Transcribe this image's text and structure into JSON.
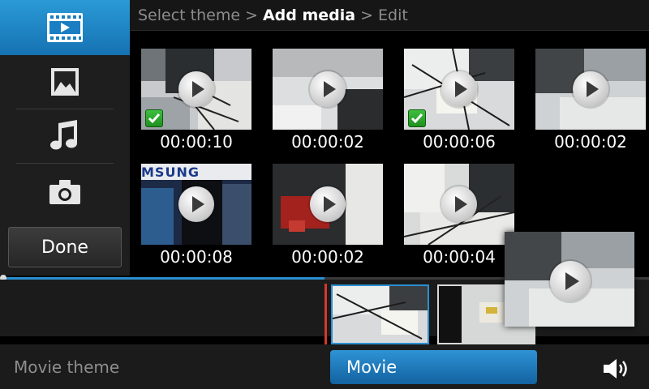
{
  "breadcrumb": {
    "step1": "Select theme",
    "sep1": ">",
    "step2": "Add media",
    "sep2": ">",
    "step3": "Edit"
  },
  "sidebar": {
    "items": [
      {
        "icon": "video-filmstrip-icon",
        "active": true
      },
      {
        "icon": "image-icon",
        "active": false
      },
      {
        "icon": "music-note-icon",
        "active": false
      },
      {
        "icon": "camera-icon",
        "active": false
      }
    ],
    "done_label": "Done"
  },
  "media": [
    {
      "duration": "00:00:10",
      "selected": true
    },
    {
      "duration": "00:00:02",
      "selected": false
    },
    {
      "duration": "00:00:06",
      "selected": true
    },
    {
      "duration": "00:00:02",
      "selected": false
    },
    {
      "duration": "00:00:08",
      "selected": false
    },
    {
      "duration": "00:00:02",
      "selected": false
    },
    {
      "duration": "00:00:04",
      "selected": false
    }
  ],
  "thumbnail_text": {
    "banner": "MSUNG"
  },
  "progress": 0.5,
  "bottom": {
    "theme_label": "Movie theme",
    "movie_button": "Movie"
  },
  "colors": {
    "accent": "#1f86cc",
    "playhead": "#d23a2a",
    "check": "#2ea82e"
  }
}
